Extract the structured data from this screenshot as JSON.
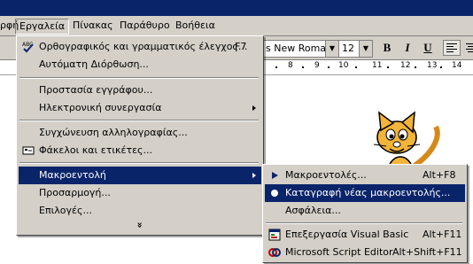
{
  "menubar": {
    "items": [
      {
        "label": "ρφή"
      },
      {
        "label": "Εργαλεία"
      },
      {
        "label": "Πίνακας"
      },
      {
        "label": "Παράθυρο"
      },
      {
        "label": "Βοήθεια"
      }
    ]
  },
  "toolbar": {
    "font_name": "s New Roman",
    "font_size": "12",
    "bold": "B",
    "italic": "I",
    "underline": "U"
  },
  "ruler": {
    "numbers": [
      "8",
      "9",
      "10",
      "11",
      "12",
      "13",
      "14"
    ]
  },
  "tools_menu": {
    "items": [
      {
        "label": "Ορθογραφικός και γραμματικός έλεγχος...",
        "shortcut": "F7",
        "icon": "spelling-check-icon"
      },
      {
        "label": "Αυτόματη Διόρθωση..."
      },
      {
        "label": "Προστασία εγγράφου..."
      },
      {
        "label": "Ηλεκτρονική συνεργασία"
      },
      {
        "label": "Συγχώνευση αλληλογραφίας..."
      },
      {
        "label": "Φάκελοι και ετικέτες...",
        "icon": "envelope-icon"
      },
      {
        "label": "Μακροεντολή"
      },
      {
        "label": "Προσαρμογή..."
      },
      {
        "label": "Επιλογές..."
      }
    ],
    "expand_glyph": "»"
  },
  "macro_menu": {
    "items": [
      {
        "label": "Μακροεντολές...",
        "shortcut": "Alt+F8",
        "icon": "play-icon"
      },
      {
        "label": "Καταγραφή νέας μακροεντολής...",
        "icon": "record-icon"
      },
      {
        "label": "Ασφάλεια..."
      },
      {
        "label": "Επεξεργασία Visual Basic",
        "shortcut": "Alt+F11",
        "icon": "visual-basic-icon"
      },
      {
        "label": "Microsoft Script Editor",
        "shortcut": "Alt+Shift+F11",
        "icon": "script-editor-icon"
      }
    ]
  },
  "colors": {
    "menu_bg": "#d4d0c8",
    "highlight": "#0a246a",
    "title_bar": "#0a246a"
  }
}
